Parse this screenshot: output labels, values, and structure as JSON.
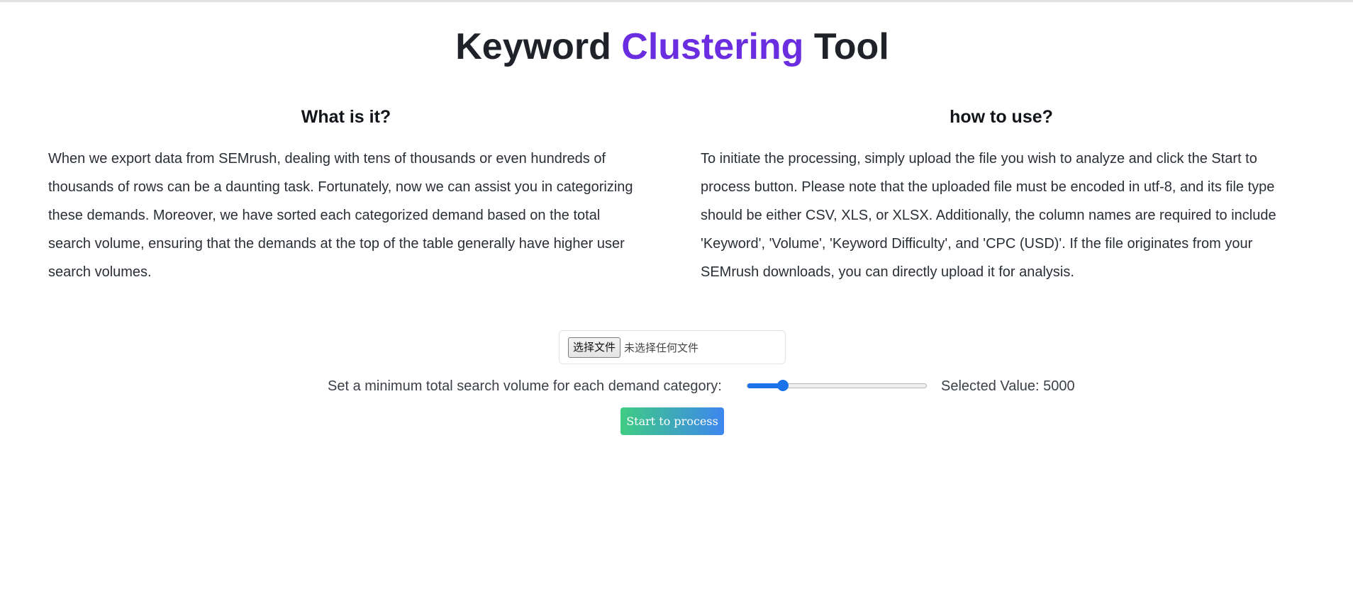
{
  "header": {
    "title_part1": "Keyword ",
    "title_accent": "Clustering",
    "title_part2": " Tool",
    "accent_color": "#6a2ee0"
  },
  "what_is_it": {
    "heading": "What is it?",
    "body": "When we export data from SEMrush, dealing with tens of thousands or even hundreds of thousands of rows can be a daunting task. Fortunately, now we can assist you in categorizing these demands. Moreover, we have sorted each categorized demand based on the total search volume, ensuring that the demands at the top of the table generally have higher user search volumes."
  },
  "how_to_use": {
    "heading": "how to use?",
    "body": "To initiate the processing, simply upload the file you wish to analyze and click the Start to process button. Please note that the uploaded file must be encoded in utf-8, and its file type should be either CSV, XLS, or XLSX. Additionally, the column names are required to include 'Keyword', 'Volume', 'Keyword Difficulty', and 'CPC (USD)'. If the file originates from your SEMrush downloads, you can directly upload it for analysis."
  },
  "upload": {
    "choose_button": "选择文件",
    "status": "未选择任何文件"
  },
  "slider": {
    "label": "Set a minimum total search volume for each demand category:",
    "fraction": 0.2,
    "selected_text": "Selected Value: 5000",
    "color": "#1a73e8"
  },
  "actions": {
    "start_label": "Start to process",
    "gradient_start": "#3fcc83",
    "gradient_end": "#3d86ee"
  }
}
